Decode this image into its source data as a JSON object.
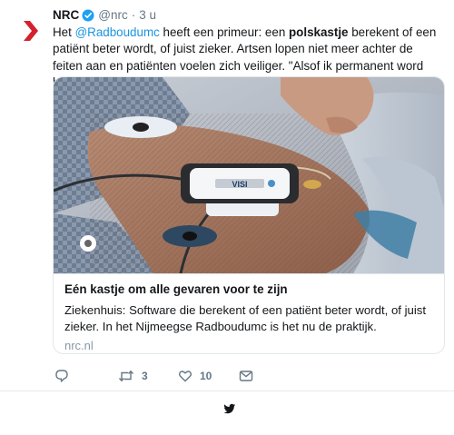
{
  "tweet": {
    "author_name": "NRC",
    "handle": "@nrc",
    "separator": "·",
    "time": "3 u",
    "text": {
      "part1": "Het ",
      "mention": "@Radboudumc",
      "part2": " heeft een primeur: een ",
      "bold": "polskastje",
      "part3": " berekent of een patiënt beter wordt, of juist zieker. Artsen lopen niet meer achter de feiten aan en patiënten voelen zich veiliger. \"Alsof ik permanent word bewaakt.\""
    }
  },
  "card": {
    "title": "Eén kastje om alle gevaren voor te zijn",
    "description": "Ziekenhuis: Software die berekent of een patiënt beter wordt, of juist zieker. In het Nijmeegse Radboudumc is het nu de praktijk.",
    "domain": "nrc.nl",
    "device_label": "VISI"
  },
  "actions": {
    "reply_icon": "reply-icon",
    "retweet_icon": "retweet-icon",
    "retweet_count": "3",
    "like_icon": "heart-icon",
    "like_count": "10",
    "share_icon": "envelope-icon"
  },
  "footer": {
    "logo_icon": "twitter-bird-icon"
  },
  "colors": {
    "brand_red": "#d3212d",
    "link_blue": "#1b95e0",
    "verified_blue": "#1da1f2",
    "muted_gray": "#657786",
    "border": "#e1e8ed",
    "bird": "#14171a"
  }
}
